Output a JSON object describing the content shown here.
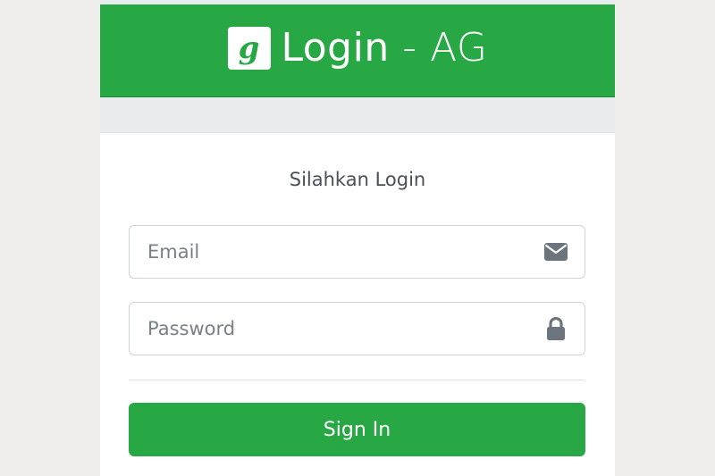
{
  "header": {
    "logo_letter": "g",
    "title_main": "Login",
    "title_separator": " - ",
    "title_suffix": "AG",
    "background_color": "#28a745"
  },
  "card": {
    "title": "Silahkan Login"
  },
  "form": {
    "email": {
      "placeholder": "Email",
      "value": "",
      "icon": "envelope-icon"
    },
    "password": {
      "placeholder": "Password",
      "value": "",
      "icon": "lock-icon"
    },
    "submit_label": "Sign In"
  },
  "colors": {
    "accent": "#28a745",
    "page_background": "#f0eeed",
    "icon_gray": "#6c757d"
  }
}
